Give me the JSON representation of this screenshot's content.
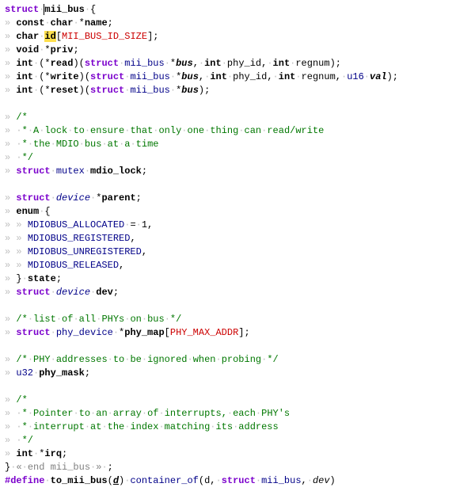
{
  "code": {
    "struct_kw": "struct",
    "struct_name": "mii_bus",
    "brace_open": "{",
    "l1_const": "const",
    "l1_char": "char",
    "l1_name": "name",
    "l2_char": "char",
    "l2_id": "id",
    "l2_size": "MII_BUS_ID_SIZE",
    "l3_void": "void",
    "l3_priv": "priv",
    "l4_int": "int",
    "l4_read": "read",
    "l4_struct": "struct",
    "l4_mii": "mii_bus",
    "l4_bus": "bus",
    "l4_int2": "int",
    "l4_phy": "phy_id",
    "l4_int3": "int",
    "l4_reg": "regnum",
    "l5_int": "int",
    "l5_write": "write",
    "l5_struct": "struct",
    "l5_mii": "mii_bus",
    "l5_bus": "bus",
    "l5_int2": "int",
    "l5_phy": "phy_id",
    "l5_int3": "int",
    "l5_reg": "regnum",
    "l5_u16": "u16",
    "l5_val": "val",
    "l6_int": "int",
    "l6_reset": "reset",
    "l6_struct": "struct",
    "l6_mii": "mii_bus",
    "l6_bus": "bus",
    "c1_open": "/*",
    "c1_l1a": "A",
    "c1_l1b": "lock",
    "c1_l1c": "to",
    "c1_l1d": "ensure",
    "c1_l1e": "that",
    "c1_l1f": "only",
    "c1_l1g": "one",
    "c1_l1h": "thing",
    "c1_l1i": "can",
    "c1_l1j": "read/write",
    "c1_l2a": "the",
    "c1_l2b": "MDIO",
    "c1_l2c": "bus",
    "c1_l2d": "at",
    "c1_l2e": "a",
    "c1_l2f": "time",
    "c1_close": "*/",
    "mutex_struct": "struct",
    "mutex_type": "mutex",
    "mutex_name": "mdio_lock",
    "parent_struct": "struct",
    "parent_type": "device",
    "parent_name": "parent",
    "enum_kw": "enum",
    "e1": "MDIOBUS_ALLOCATED",
    "e1v": "1",
    "e2": "MDIOBUS_REGISTERED",
    "e3": "MDIOBUS_UNREGISTERED",
    "e4": "MDIOBUS_RELEASED",
    "state": "state",
    "dev_struct": "struct",
    "dev_type": "device",
    "dev_name": "dev",
    "c2_open": "/*",
    "c2_a": "list",
    "c2_b": "of",
    "c2_c": "all",
    "c2_d": "PHYs",
    "c2_e": "on",
    "c2_f": "bus",
    "c2_close": "*/",
    "pm_struct": "struct",
    "pm_type": "phy_device",
    "pm_name": "phy_map",
    "pm_size": "PHY_MAX_ADDR",
    "c3_open": "/*",
    "c3_a": "PHY",
    "c3_b": "addresses",
    "c3_c": "to",
    "c3_d": "be",
    "c3_e": "ignored",
    "c3_f": "when",
    "c3_g": "probing",
    "c3_close": "*/",
    "mask_type": "u32",
    "mask_name": "phy_mask",
    "c4_open": "/*",
    "c4_l1a": "Pointer",
    "c4_l1b": "to",
    "c4_l1c": "an",
    "c4_l1d": "array",
    "c4_l1e": "of",
    "c4_l1f": "interrupts,",
    "c4_l1g": "each",
    "c4_l1h": "PHY's",
    "c4_l2a": "interrupt",
    "c4_l2b": "at",
    "c4_l2c": "the",
    "c4_l2d": "index",
    "c4_l2e": "matching",
    "c4_l2f": "its",
    "c4_l2g": "address",
    "c4_close": "*/",
    "irq_int": "int",
    "irq_name": "irq",
    "brace_close": "}",
    "fold_text": "end mii_bus",
    "pp_define": "#define",
    "pp_macro": "to_mii_bus",
    "pp_arg": "d",
    "pp_container": "container_of",
    "pp_d": "d",
    "pp_struct": "struct",
    "pp_mii": "mii_bus",
    "pp_dev": "dev"
  },
  "ws": {
    "tab": "»",
    "dot": "·",
    "star": "*",
    "fold_open": "«",
    "fold_close": "»"
  }
}
